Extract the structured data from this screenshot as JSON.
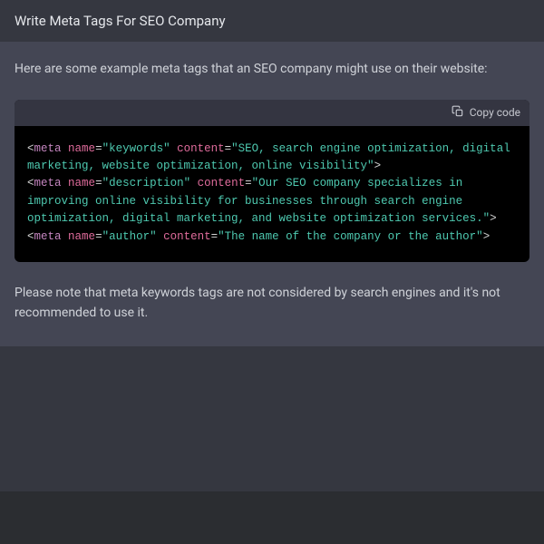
{
  "header": {
    "title": "Write Meta Tags For SEO Company"
  },
  "intro": "Here are some example meta tags that an SEO company might use on their website:",
  "code": {
    "copy_label": "Copy code",
    "tag1_name": "meta",
    "tag1_attr_name": "name",
    "tag1_attr_name_val": "\"keywords\"",
    "tag1_attr_content": "content",
    "tag1_attr_content_val": "\"SEO, search engine optimization, digital marketing, website optimization, online visibility\"",
    "tag2_name": "meta",
    "tag2_attr_name": "name",
    "tag2_attr_name_val": "\"description\"",
    "tag2_attr_content": "content",
    "tag2_attr_content_val": "\"Our SEO company specializes in improving online visibility for businesses through search engine optimization, digital marketing, and website optimization services.\"",
    "tag3_name": "meta",
    "tag3_attr_name": "name",
    "tag3_attr_name_val": "\"author\"",
    "tag3_attr_content": "content",
    "tag3_attr_content_val": "\"The name of the company or the author\""
  },
  "note": "Please note that meta keywords tags are not considered by search engines and it's not recommended to use it."
}
